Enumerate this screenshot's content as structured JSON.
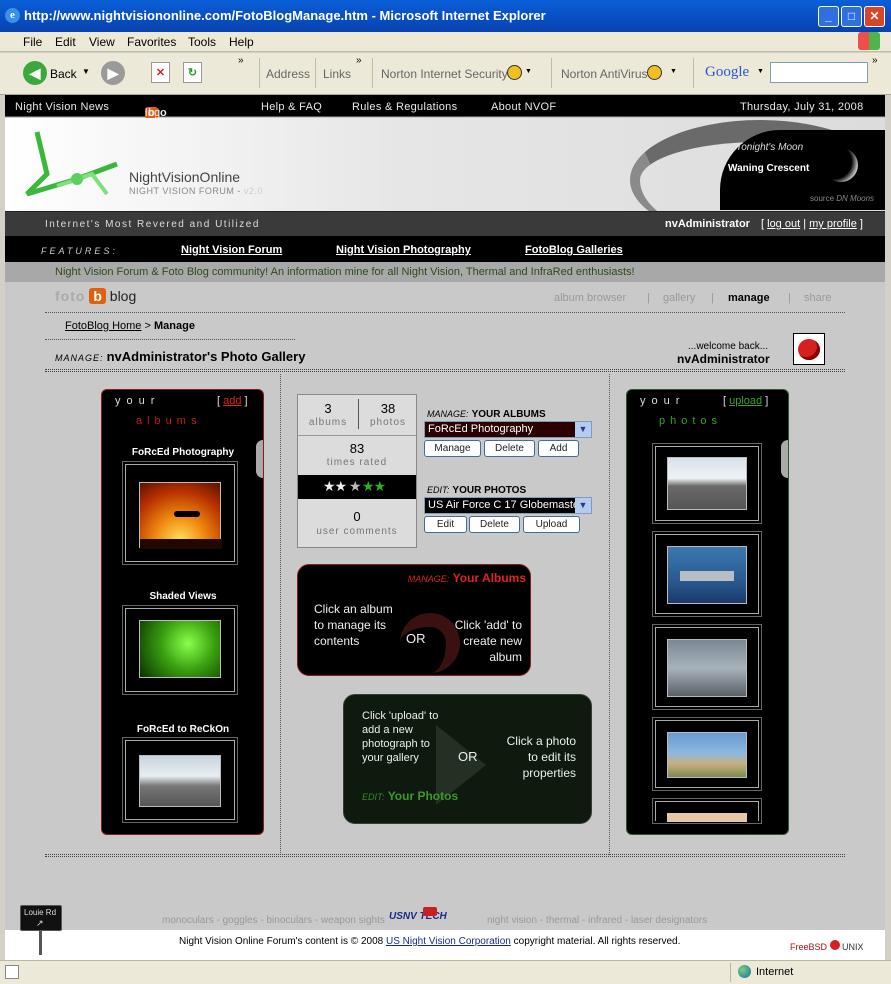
{
  "window": {
    "title": "http://www.nightvisiononline.com/FotoBlogManage.htm - Microsoft Internet Explorer"
  },
  "menu": [
    "File",
    "Edit",
    "View",
    "Favorites",
    "Tools",
    "Help"
  ],
  "toolbar": {
    "back": "Back",
    "address": "Address",
    "links": "Links",
    "norton_security": "Norton Internet Security",
    "norton_av": "Norton AntiVirus",
    "google": "Google"
  },
  "topnav": {
    "news": "Night Vision News",
    "foto": "foto",
    "b": "b",
    "log": "log",
    "help": "Help & FAQ",
    "rules": "Rules & Regulations",
    "about": "About NVOF",
    "date": "Thursday, July 31, 2008"
  },
  "banner": {
    "site": "NightVisionOnline",
    "sub": "NIGHT VISION FORUM - ",
    "ver": "v2.0",
    "moon_title": "Tonight's Moon",
    "moon_phase": "Waning Crescent",
    "moon_source": "source",
    "moon_source2": "DN Moons"
  },
  "tagbar": {
    "tagline": "Internet's Most Revered and Utilized",
    "user": "nvAdministrator",
    "logout": "log out",
    "profile": "my profile"
  },
  "features": {
    "label": "FEATURES:",
    "f1": "Night Vision Forum",
    "f2": "Night Vision Photography",
    "f3": "FotoBlog Galleries"
  },
  "slogan": "Night Vision Forum & Foto Blog community! An information mine for all Night Vision, Thermal and InfraRed enthusiasts!",
  "fotoblog": {
    "foto": "foto",
    "b": "b",
    "log": "blog",
    "tabs": [
      "album browser",
      "gallery",
      "manage",
      "share"
    ]
  },
  "breadcrumb": {
    "home": "FotoBlog Home",
    "sep": " > ",
    "current": "Manage"
  },
  "gallery": {
    "manage_label": "MANAGE:",
    "title": "nvAdministrator's Photo Gallery",
    "welcome": "...welcome back...",
    "user": "nvAdministrator"
  },
  "albums_panel": {
    "your": "your",
    "albums": "albums",
    "add": "add",
    "items": [
      "FoRcEd Photography",
      "Shaded Views",
      "FoRcEd to ReCkOn"
    ]
  },
  "photos_panel": {
    "your": "your",
    "photos": "photos",
    "upload": "upload"
  },
  "stats": {
    "albums_n": "3",
    "albums": "albums",
    "photos_n": "38",
    "photos": "photos",
    "rated_n": "83",
    "rated": "times rated",
    "comments_n": "0",
    "comments": "user comments"
  },
  "manage_albums": {
    "label": "MANAGE:",
    "title": "YOUR ALBUMS",
    "selected": "FoRcEd Photography",
    "buttons": [
      "Manage",
      "Delete",
      "Add"
    ]
  },
  "edit_photos": {
    "label": "EDIT:",
    "title": "YOUR PHOTOS",
    "selected": "US Air Force C 17 Globemaster",
    "buttons": [
      "Edit",
      "Delete",
      "Upload"
    ]
  },
  "info_albums": {
    "label": "MANAGE:",
    "title": "Your Albums",
    "left": "Click an album to manage its contents",
    "or": "OR",
    "right": "Click 'add' to create new album"
  },
  "info_photos": {
    "label": "EDIT:",
    "title": "Your Photos",
    "left": "Click 'upload' to add a new photograph to your gallery",
    "or": "OR",
    "right": "Click a photo to edit its properties"
  },
  "footer": {
    "left": "monoculars - goggles - binoculars - weapon sights",
    "logo": "USNV TECH",
    "right": "night vision - thermal - infrared - laser designators",
    "copy1": "Night Vision Online Forum's content is © 2008 ",
    "copy_link": "US Night Vision Corporation",
    "copy2": " copyright material. All rights reserved.",
    "sign": "Louie Rd",
    "freebsd": "FreeBSD",
    "unix": "UNIX"
  },
  "status": {
    "zone": "Internet"
  }
}
